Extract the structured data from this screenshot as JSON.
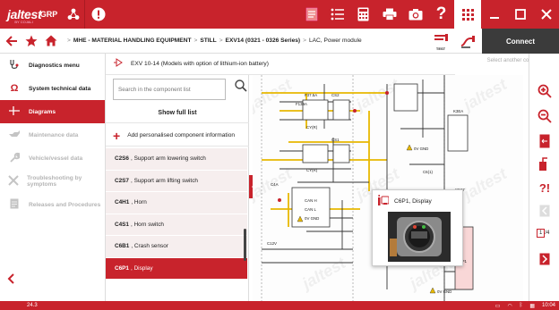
{
  "app": {
    "logo": "jaltest",
    "logo_sub": "BY COJALI",
    "product": "GRP",
    "version": "24.3",
    "clock": "10:04",
    "page_indicator": {
      "current": "1",
      "total": "/4"
    }
  },
  "breadcrumb": [
    "MHE - MATERIAL HANDLING EQUIPMENT",
    "STILL",
    "EXV14 (0321 - 0326 Series)",
    "LAC, Power module"
  ],
  "nav_tools": {
    "test_tag": "TEST"
  },
  "connect": {
    "label": "Connect",
    "select_config": "Select another configuration"
  },
  "model": {
    "label": "EXV 10-14 (Models with option of lithium-ion battery)"
  },
  "left_menu": [
    {
      "label": "Diagnostics menu",
      "icon": "stethoscope-icon",
      "state": "normal"
    },
    {
      "label": "System technical data",
      "icon": "omega-icon",
      "state": "normal"
    },
    {
      "label": "Diagrams",
      "icon": "diagram-icon",
      "state": "active"
    },
    {
      "label": "Maintenance data",
      "icon": "oil-can-icon",
      "state": "disabled"
    },
    {
      "label": "Vehicle/vessel data",
      "icon": "wrench-icon",
      "state": "disabled"
    },
    {
      "label": "Troubleshooting by symptoms",
      "icon": "tools-icon",
      "state": "disabled"
    },
    {
      "label": "Releases and Procedures",
      "icon": "document-icon",
      "state": "disabled"
    }
  ],
  "component_list": {
    "search_placeholder": "Search in the component list",
    "full_list": "Show full list",
    "add_personalised": "Add personalised component information",
    "items": [
      {
        "code": "C2S6",
        "name": "Support arm lowering switch"
      },
      {
        "code": "C2S7",
        "name": "Support arm lifting switch"
      },
      {
        "code": "C4H1",
        "name": "Horn"
      },
      {
        "code": "C4S1",
        "name": "Horn switch"
      },
      {
        "code": "C6B1",
        "name": "Crash sensor"
      },
      {
        "code": "C6P1",
        "name": "Display"
      }
    ],
    "selected": "C6P1"
  },
  "popup": {
    "title": "C6P1, Display"
  },
  "diagram_labels": {
    "f37": "F37.5A",
    "f139": "F139A",
    "cs2": "CS2",
    "cs1": "CS1",
    "cyr": "CY(R)",
    "gnd": "0V GND",
    "c4a": "C4A",
    "can_h": "CAN H",
    "can_l": "CAN L",
    "c12v": "C12V",
    "k3ea": "K3EA",
    "c61": "C6(1)",
    "c6p1": "C6P1",
    "x6x7": "X6X7"
  },
  "colors": {
    "brand": "#c8232c",
    "wire_yellow": "#e8b800",
    "dark": "#3b3b3b"
  }
}
